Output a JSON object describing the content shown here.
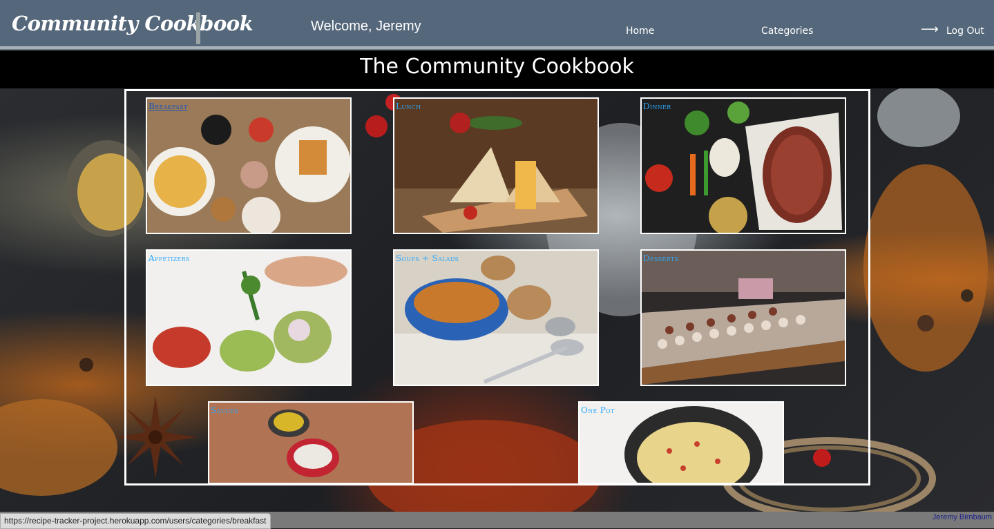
{
  "header": {
    "brand": "Community Cookbook",
    "welcome": "Welcome, Jeremy",
    "nav": {
      "home": "Home",
      "categories": "Categories",
      "logout": "Log Out"
    },
    "logout_icon": "arrow-right-icon"
  },
  "page_title": "The Community Cookbook",
  "categories": [
    {
      "label": "Breakfast"
    },
    {
      "label": "Lunch"
    },
    {
      "label": "Dinner"
    },
    {
      "label": "Appetizers"
    },
    {
      "label": "Soups + Salads"
    },
    {
      "label": "Desserts"
    },
    {
      "label": "Sauces"
    },
    {
      "label": "One Pot"
    }
  ],
  "footer": {
    "author": "Jeremy Birnbaum",
    "status_url": "https://recipe-tracker-project.herokuapp.com/users/categories/breakfast"
  },
  "colors": {
    "header_bg": "#55677a",
    "title_band_bg": "#000000",
    "category_label": "#2aa8ff",
    "footer_bg": "#7a7a7a"
  }
}
